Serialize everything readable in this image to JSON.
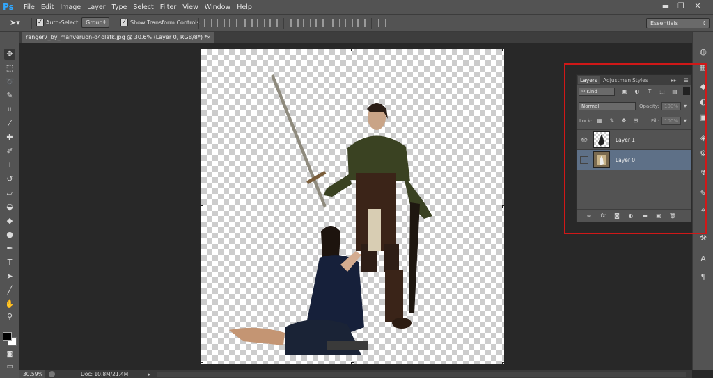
{
  "app": {
    "logo": "Ps"
  },
  "menu": [
    "File",
    "Edit",
    "Image",
    "Layer",
    "Type",
    "Select",
    "Filter",
    "View",
    "Window",
    "Help"
  ],
  "window_controls": {
    "minimize": "▬",
    "restore": "❐",
    "close": "✕"
  },
  "options": {
    "auto_select_label": "Auto-Select:",
    "auto_select_value": "Group",
    "show_transform_label": "Show Transform Controls",
    "workspace": "Essentials"
  },
  "document": {
    "tab_title": "ranger7_by_manveruon-d4olafk.jpg @ 30.6% (Layer 0, RGB/8*) *",
    "close": "×"
  },
  "layers_panel": {
    "tabs": [
      "Layers",
      "Adjustmen",
      "Styles"
    ],
    "filter_label": "Kind",
    "blend_mode": "Normal",
    "opacity_label": "Opacity:",
    "opacity_value": "100%",
    "lock_label": "Lock:",
    "fill_label": "Fill:",
    "fill_value": "100%",
    "layers": [
      {
        "name": "Layer 1",
        "visible": true,
        "selected": false
      },
      {
        "name": "Layer 0",
        "visible": false,
        "selected": true
      }
    ]
  },
  "status": {
    "zoom": "30.59%",
    "doc_info": "Doc: 10.8M/21.4M"
  },
  "colors": {
    "accent_blue": "#31a8ff",
    "selection": "#5e7087",
    "highlight_box": "#d01818"
  },
  "icons": {
    "tools": [
      "move-tool-icon",
      "marquee-tool-icon",
      "lasso-tool-icon",
      "quick-select-tool-icon",
      "crop-tool-icon",
      "eyedropper-tool-icon",
      "spot-heal-tool-icon",
      "brush-tool-icon",
      "clone-stamp-tool-icon",
      "history-brush-tool-icon",
      "eraser-tool-icon",
      "paint-bucket-tool-icon",
      "blur-tool-icon",
      "dodge-tool-icon",
      "pen-tool-icon",
      "type-tool-icon",
      "path-select-tool-icon",
      "line-tool-icon",
      "hand-tool-icon",
      "zoom-tool-icon"
    ]
  }
}
